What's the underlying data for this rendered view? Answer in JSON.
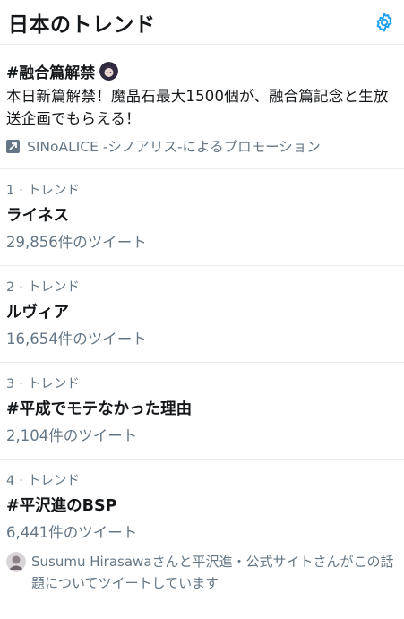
{
  "header": {
    "title": "日本のトレンド",
    "settings_icon": "gear-icon"
  },
  "colors": {
    "accent": "#1da1f2",
    "secondary_text": "#657786",
    "divider": "#e6ecf0"
  },
  "promoted": {
    "hashtag": "#融合篇解禁",
    "description": "本日新篇解禁！魔晶石最大1500個が、融合篇記念と生放送企画でもらえる！",
    "promoted_by": "SINoALICE -シノアリス-によるプロモーション",
    "badge_icon": "promoted-arrow-icon"
  },
  "trends": [
    {
      "rank": "1",
      "sep": "·",
      "label": "トレンド",
      "name": "ライネス",
      "count": "29,856件のツイート"
    },
    {
      "rank": "2",
      "sep": "·",
      "label": "トレンド",
      "name": "ルヴィア",
      "count": "16,654件のツイート"
    },
    {
      "rank": "3",
      "sep": "·",
      "label": "トレンド",
      "name": "#平成でモテなかった理由",
      "count": "2,104件のツイート"
    },
    {
      "rank": "4",
      "sep": "·",
      "label": "トレンド",
      "name": "#平沢進のBSP",
      "count": "6,441件のツイート",
      "context": "Susumu Hirasawaさんと平沢進・公式サイトさんがこの話題についてツイートしています"
    }
  ]
}
